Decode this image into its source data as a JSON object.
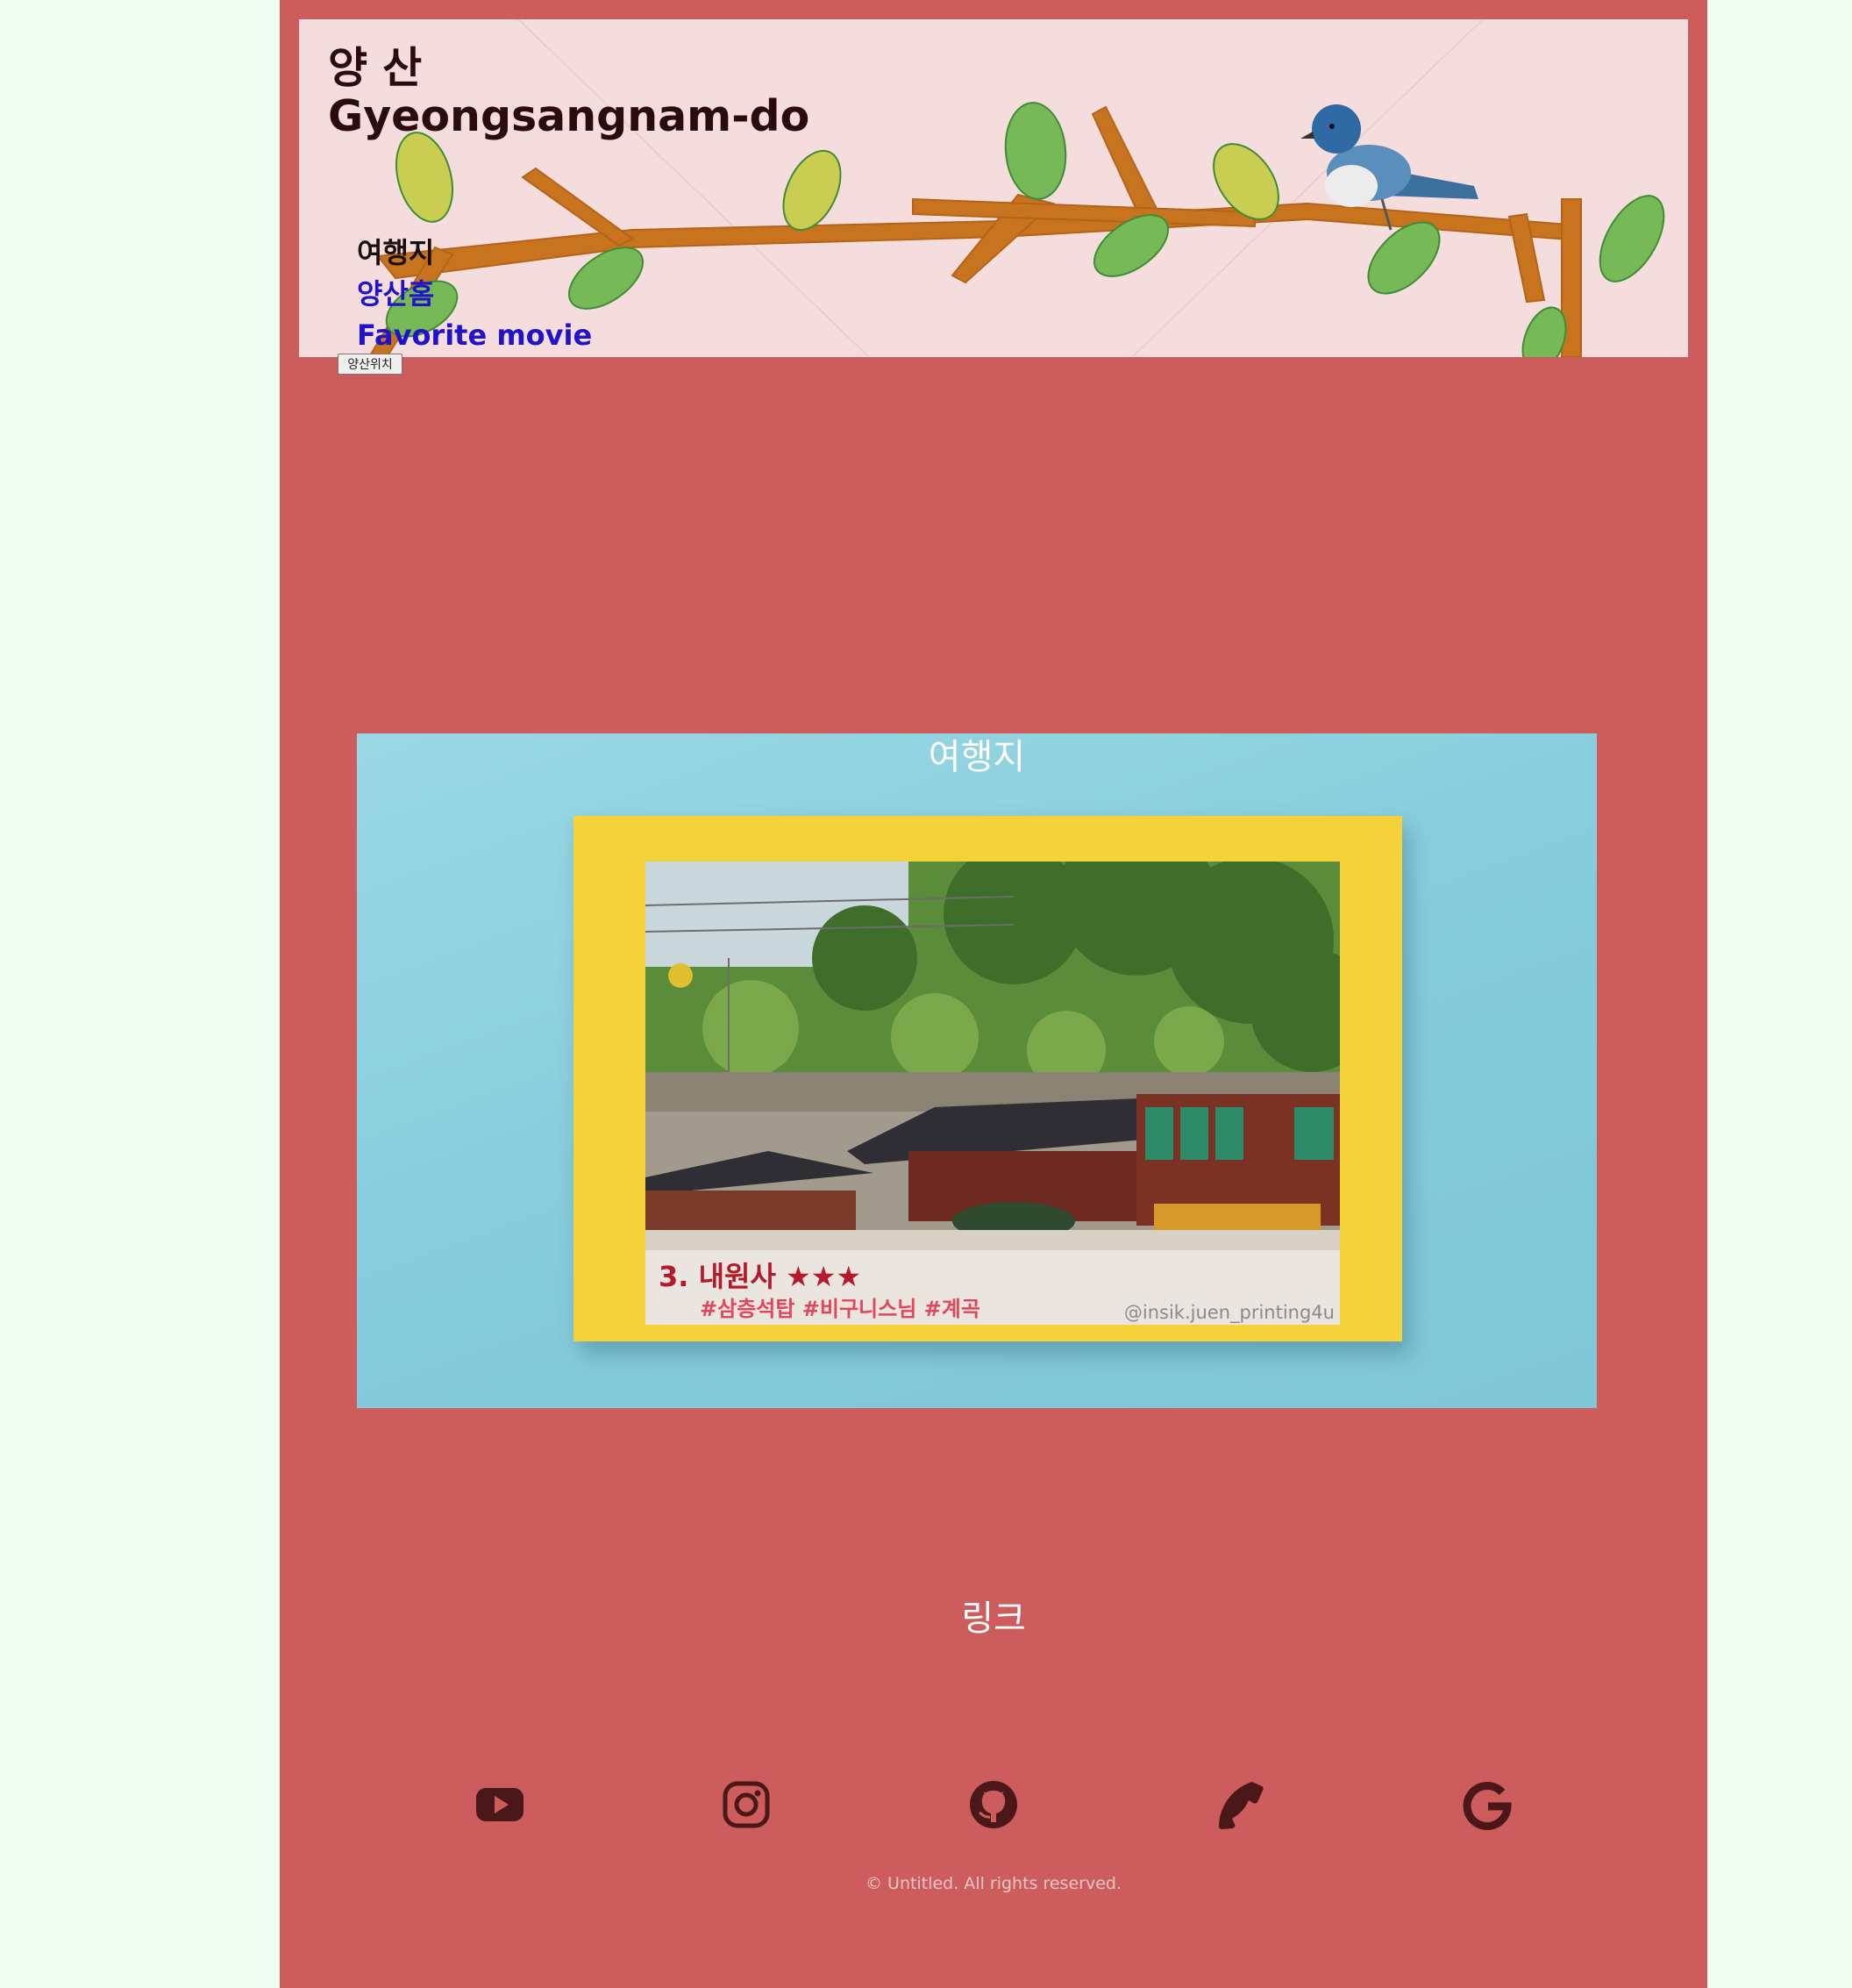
{
  "header": {
    "title_line1": "양 산",
    "title_line2": "Gyeongsangnam-do",
    "nav": [
      {
        "label": "여행지"
      },
      {
        "label": "양산홈"
      },
      {
        "label": "Favorite movie"
      }
    ],
    "location_button": "양산위치"
  },
  "destination": {
    "heading": "여행지",
    "photo_title": "3. 내원사 ★★★",
    "photo_tags": "#삼층석탑 #비구니스님 #계곡",
    "photo_credit": "@insik.juen_printing4u"
  },
  "links": {
    "heading": "링크",
    "icons": [
      "youtube-icon",
      "instagram-icon",
      "github-icon",
      "phone-icon",
      "google-icon"
    ]
  },
  "footer": {
    "copyright": "© Untitled. All rights reserved."
  },
  "colors": {
    "page_background": "#f0fdf0",
    "content_background": "#cd5c5c",
    "banner_background": "#f5dddd",
    "link": "#1f14c8",
    "icon": "#4a1818"
  }
}
